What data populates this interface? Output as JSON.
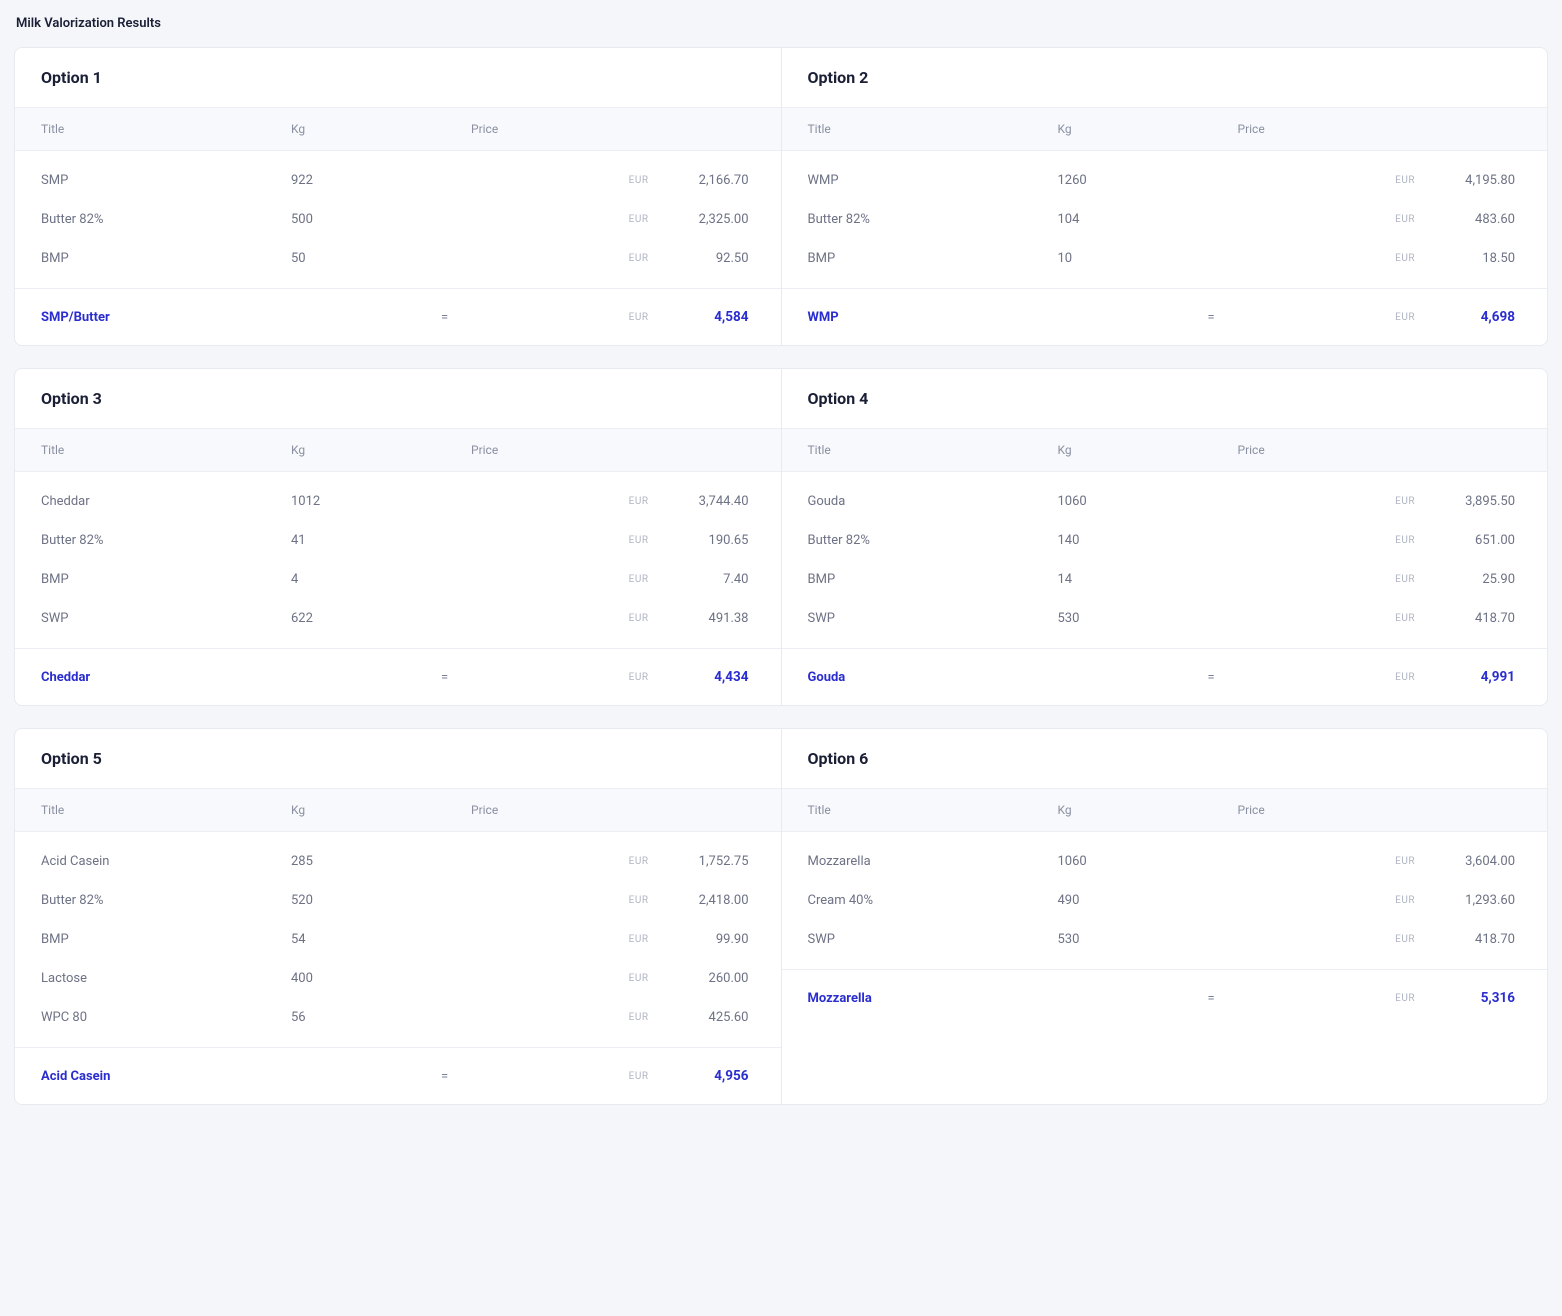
{
  "pageTitle": "Milk Valorization Results",
  "columnHeaders": {
    "title": "Title",
    "kg": "Kg",
    "price": "Price"
  },
  "currencyLabel": "EUR",
  "equals": "=",
  "rows": [
    {
      "left": {
        "heading": "Option 1",
        "items": [
          {
            "title": "SMP",
            "kg": "922",
            "price": "2,166.70"
          },
          {
            "title": "Butter 82%",
            "kg": "500",
            "price": "2,325.00"
          },
          {
            "title": "BMP",
            "kg": "50",
            "price": "92.50"
          }
        ],
        "summaryTitle": "SMP/Butter",
        "summaryTotal": "4,584"
      },
      "right": {
        "heading": "Option 2",
        "items": [
          {
            "title": "WMP",
            "kg": "1260",
            "price": "4,195.80"
          },
          {
            "title": "Butter 82%",
            "kg": "104",
            "price": "483.60"
          },
          {
            "title": "BMP",
            "kg": "10",
            "price": "18.50"
          }
        ],
        "summaryTitle": "WMP",
        "summaryTotal": "4,698"
      }
    },
    {
      "left": {
        "heading": "Option 3",
        "items": [
          {
            "title": "Cheddar",
            "kg": "1012",
            "price": "3,744.40"
          },
          {
            "title": "Butter 82%",
            "kg": "41",
            "price": "190.65"
          },
          {
            "title": "BMP",
            "kg": "4",
            "price": "7.40"
          },
          {
            "title": "SWP",
            "kg": "622",
            "price": "491.38"
          }
        ],
        "summaryTitle": "Cheddar",
        "summaryTotal": "4,434"
      },
      "right": {
        "heading": "Option 4",
        "items": [
          {
            "title": "Gouda",
            "kg": "1060",
            "price": "3,895.50"
          },
          {
            "title": "Butter 82%",
            "kg": "140",
            "price": "651.00"
          },
          {
            "title": "BMP",
            "kg": "14",
            "price": "25.90"
          },
          {
            "title": "SWP",
            "kg": "530",
            "price": "418.70"
          }
        ],
        "summaryTitle": "Gouda",
        "summaryTotal": "4,991"
      }
    },
    {
      "left": {
        "heading": "Option 5",
        "items": [
          {
            "title": "Acid Casein",
            "kg": "285",
            "price": "1,752.75"
          },
          {
            "title": "Butter 82%",
            "kg": "520",
            "price": "2,418.00"
          },
          {
            "title": "BMP",
            "kg": "54",
            "price": "99.90"
          },
          {
            "title": "Lactose",
            "kg": "400",
            "price": "260.00"
          },
          {
            "title": "WPC 80",
            "kg": "56",
            "price": "425.60"
          }
        ],
        "summaryTitle": "Acid Casein",
        "summaryTotal": "4,956"
      },
      "right": {
        "heading": "Option 6",
        "items": [
          {
            "title": "Mozzarella",
            "kg": "1060",
            "price": "3,604.00"
          },
          {
            "title": "Cream 40%",
            "kg": "490",
            "price": "1,293.60"
          },
          {
            "title": "SWP",
            "kg": "530",
            "price": "418.70"
          }
        ],
        "summaryTitle": "Mozzarella",
        "summaryTotal": "5,316"
      }
    }
  ]
}
